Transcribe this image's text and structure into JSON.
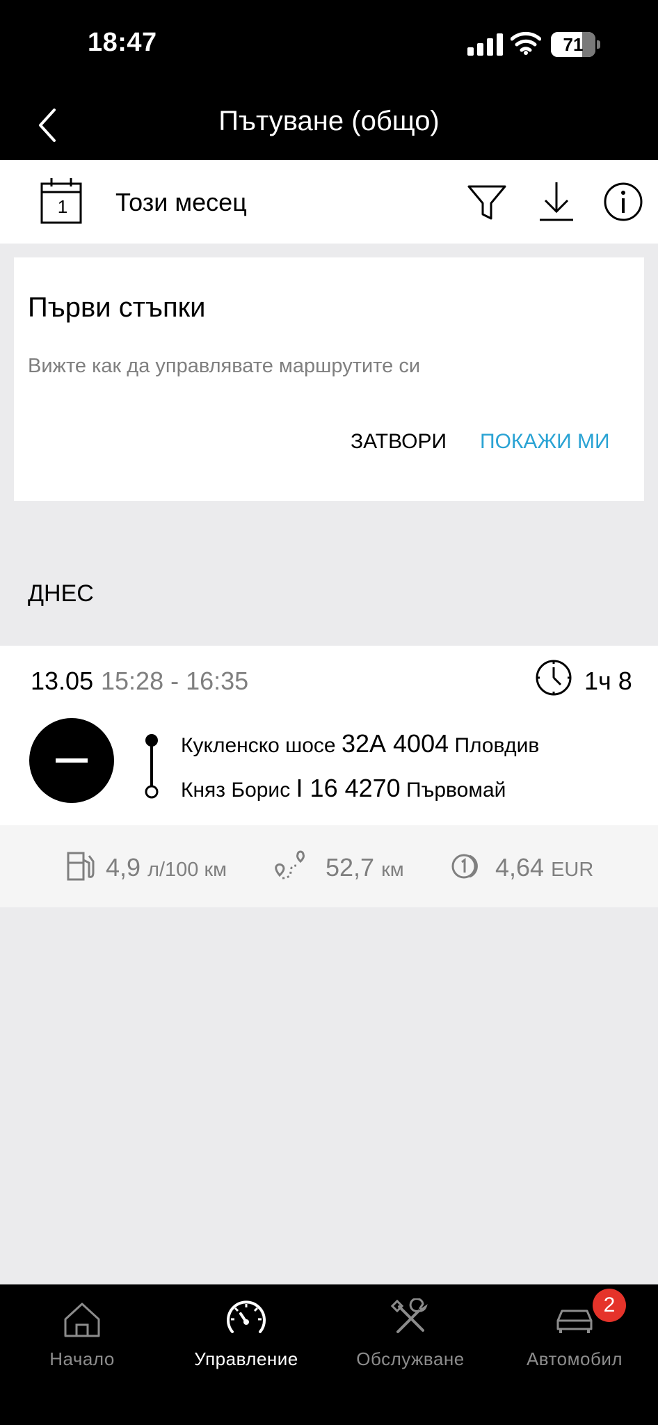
{
  "status_bar": {
    "time": "18:47",
    "battery_percent": "71",
    "battery_level": 0.71
  },
  "header": {
    "title": "Пътуване (общо)"
  },
  "toolbar": {
    "calendar_day": "1",
    "period_label": "Този месец"
  },
  "intro_card": {
    "title": "Първи стъпки",
    "subtitle": "Вижте как да управлявате маршрутите си",
    "close_label": "ЗАТВОРИ",
    "show_label": "ПОКАЖИ МИ"
  },
  "section": {
    "label": "ДНЕС"
  },
  "trip": {
    "date": "13.05",
    "time_range": "15:28 - 16:35",
    "duration": "1ч 8",
    "start": {
      "street": "Кукленско шосе",
      "number_zip": "32А 4004",
      "city": "Пловдив"
    },
    "end": {
      "street": "Княз Борис",
      "number_zip": "I 16 4270",
      "city": "Първомай"
    },
    "stats": {
      "consumption_value": "4,9",
      "consumption_unit": "л/100 км",
      "distance_value": "52,7",
      "distance_unit": "км",
      "cost_value": "4,64",
      "cost_unit": "EUR"
    }
  },
  "tabs": [
    {
      "label": "Начало",
      "icon": "home-icon"
    },
    {
      "label": "Управление",
      "icon": "speedometer-icon"
    },
    {
      "label": "Обслужване",
      "icon": "tools-icon"
    },
    {
      "label": "Автомобил",
      "icon": "car-icon"
    }
  ],
  "active_tab_index": 1,
  "car_badge": "2",
  "colors": {
    "accent": "#2aa3d4",
    "badge": "#e5332a",
    "background": "#ebebed"
  }
}
